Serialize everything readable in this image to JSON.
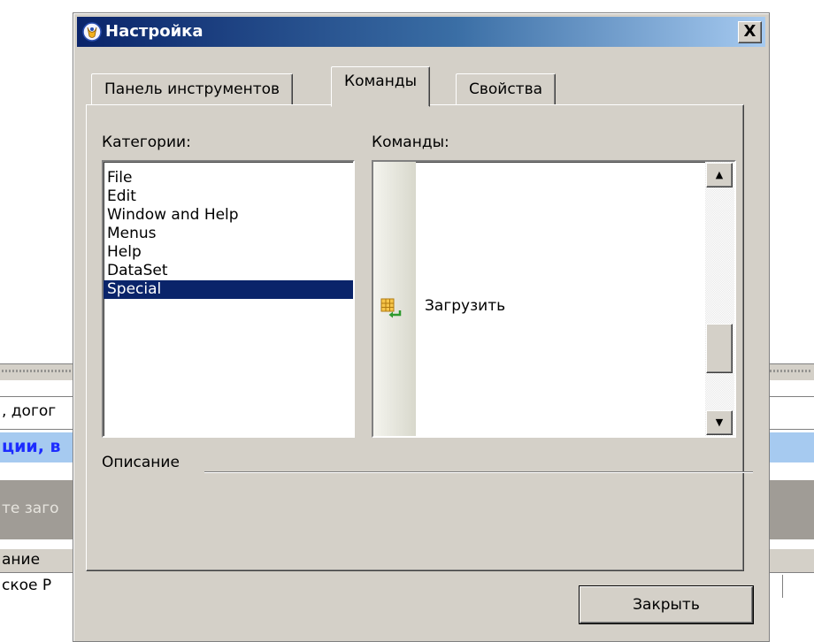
{
  "background_app": {
    "row1_text": ", догог",
    "row2_text": "ции, в",
    "row3_text": "те заго",
    "row4_text": "ание",
    "row5_text": "ское Р"
  },
  "dialog": {
    "title": "Настройка",
    "close_label": "X",
    "tabs": [
      "Панель инструментов",
      "Команды",
      "Свойства"
    ],
    "active_tab": "Команды",
    "categories_label": "Категории:",
    "commands_label": "Команды:",
    "categories": [
      "File",
      "Edit",
      "Window and Help",
      "Menus",
      "Help",
      "DataSet",
      "Special"
    ],
    "selected_category": "Special",
    "commands": [
      {
        "label": "Загрузить",
        "icon": "load-grid-icon"
      }
    ],
    "description_label": "Описание",
    "close_button": "Закрыть"
  },
  "colors": {
    "title_bar_start": "#0a246a",
    "title_bar_end": "#a6caf0",
    "selection": "#0a246a",
    "face": "#d4d0c8"
  }
}
